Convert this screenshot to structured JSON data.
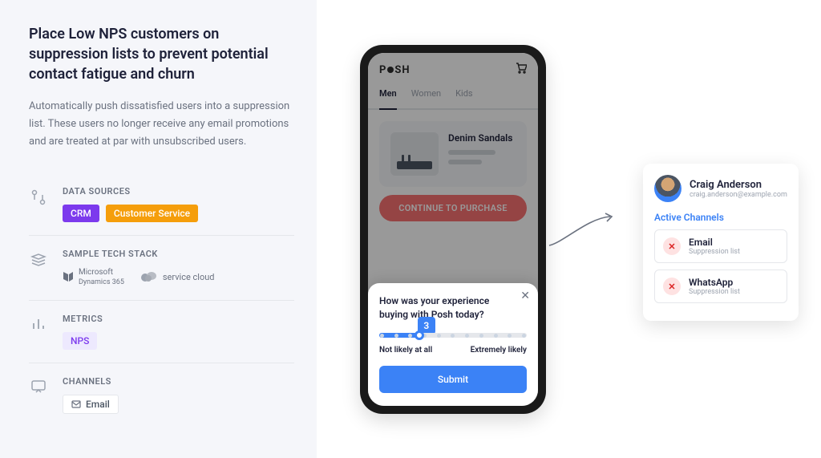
{
  "close_icon": "×",
  "left": {
    "title": "Place Low NPS customers on suppression lists to prevent potential contact fatigue and churn",
    "description": "Automatically push dissatisfied users into a suppression list. These users no longer receive any email promotions and are treated at par with unsubscribed users.",
    "sections": {
      "data_sources": {
        "label": "DATA SOURCES",
        "tags": [
          "CRM",
          "Customer Service"
        ]
      },
      "tech_stack": {
        "label": "SAMPLE TECH STACK",
        "items": [
          "Microsoft Dynamics 365",
          "service cloud"
        ]
      },
      "metrics": {
        "label": "METRICS",
        "tags": [
          "NPS"
        ]
      },
      "channels": {
        "label": "CHANNELS",
        "tags": [
          "Email"
        ]
      }
    }
  },
  "phone": {
    "brand": "POSH",
    "tabs": [
      "Men",
      "Women",
      "Kids"
    ],
    "product_name": "Denim Sandals",
    "cta": "CONTINUE TO PURCHASE",
    "survey": {
      "question": "How was your experience buying with Posh today?",
      "value": "3",
      "min_label": "Not likely at all",
      "max_label": "Extremely likely",
      "submit": "Submit"
    }
  },
  "user_card": {
    "name": "Craig Anderson",
    "email": "craig.anderson@example.com",
    "channels_label": "Active Channels",
    "channels": [
      {
        "name": "Email",
        "status": "Suppression list"
      },
      {
        "name": "WhatsApp",
        "status": "Suppression list"
      }
    ]
  }
}
